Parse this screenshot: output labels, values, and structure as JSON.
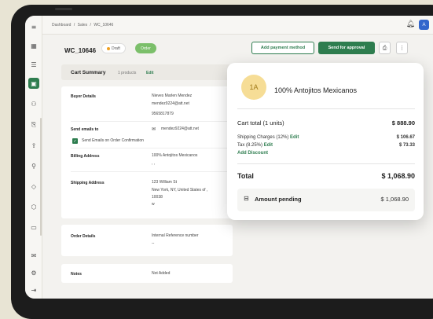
{
  "breadcrumb": {
    "dashboard": "Dashboard",
    "sep": "/",
    "sales": "Sales",
    "current": "WC_10646"
  },
  "header": {
    "order_id": "WC_10646",
    "draft_badge": "Draft",
    "order_badge": "Order",
    "add_payment": "Add payment method",
    "send_approval": "Send for approval"
  },
  "user": {
    "avatar": "A"
  },
  "cart": {
    "title": "Cart Summary",
    "count": "1 products",
    "edit": "Edit"
  },
  "buyer": {
    "label": "Buyer Details",
    "name": "Nieves Marlen Mendez",
    "email": "mendez9224@att.net",
    "phone": "9565817879"
  },
  "send_emails": {
    "label": "Send emails to",
    "email": "mendez9224@att.net",
    "checkbox_label": "Send Emails on Order Confirmation"
  },
  "billing": {
    "label": "Billing Address",
    "line1": "100% Antojitos Mexicanos",
    "line2": ", ,"
  },
  "shipping": {
    "label": "Shipping Address",
    "line1": "123 William St",
    "line2": "New York, NY, United States of ,",
    "line3": "10038",
    "line4": "w"
  },
  "order_details": {
    "label": "Order Details",
    "field": "Internal Reference number",
    "value": "--"
  },
  "notes": {
    "label": "Notes",
    "value": "Not Added"
  },
  "popup": {
    "initials": "1A",
    "customer": "100% Antojitos Mexicanos",
    "cart_total_label": "Cart total (1 units)",
    "cart_total_value": "$ 888.90",
    "shipping_label": "Shipping Charges (12%)",
    "shipping_edit": "Edit",
    "shipping_value": "$ 106.67",
    "tax_label": "Tax (8.25%)",
    "tax_edit": "Edit",
    "tax_value": "$ 73.33",
    "add_discount": "Add Discount",
    "total_label": "Total",
    "total_value": "$ 1,068.90",
    "pending_label": "Amount pending",
    "pending_value": "$ 1,068.90"
  },
  "colors": {
    "accent": "#2e7d4f",
    "draft_dot": "#f0a020",
    "order_badge": "#7bbf6a",
    "avatar_bg": "#3366cc"
  },
  "icons": [
    "menu-icon",
    "dashboard-icon",
    "list-icon",
    "orders-icon",
    "users-icon",
    "document-icon",
    "rocket-icon",
    "person-icon",
    "tag-icon",
    "box-icon",
    "folder-icon",
    "mail-icon",
    "settings-icon",
    "logout-icon",
    "bell-icon",
    "pdf-icon",
    "more-icon",
    "envelope-icon",
    "wallet-icon"
  ]
}
